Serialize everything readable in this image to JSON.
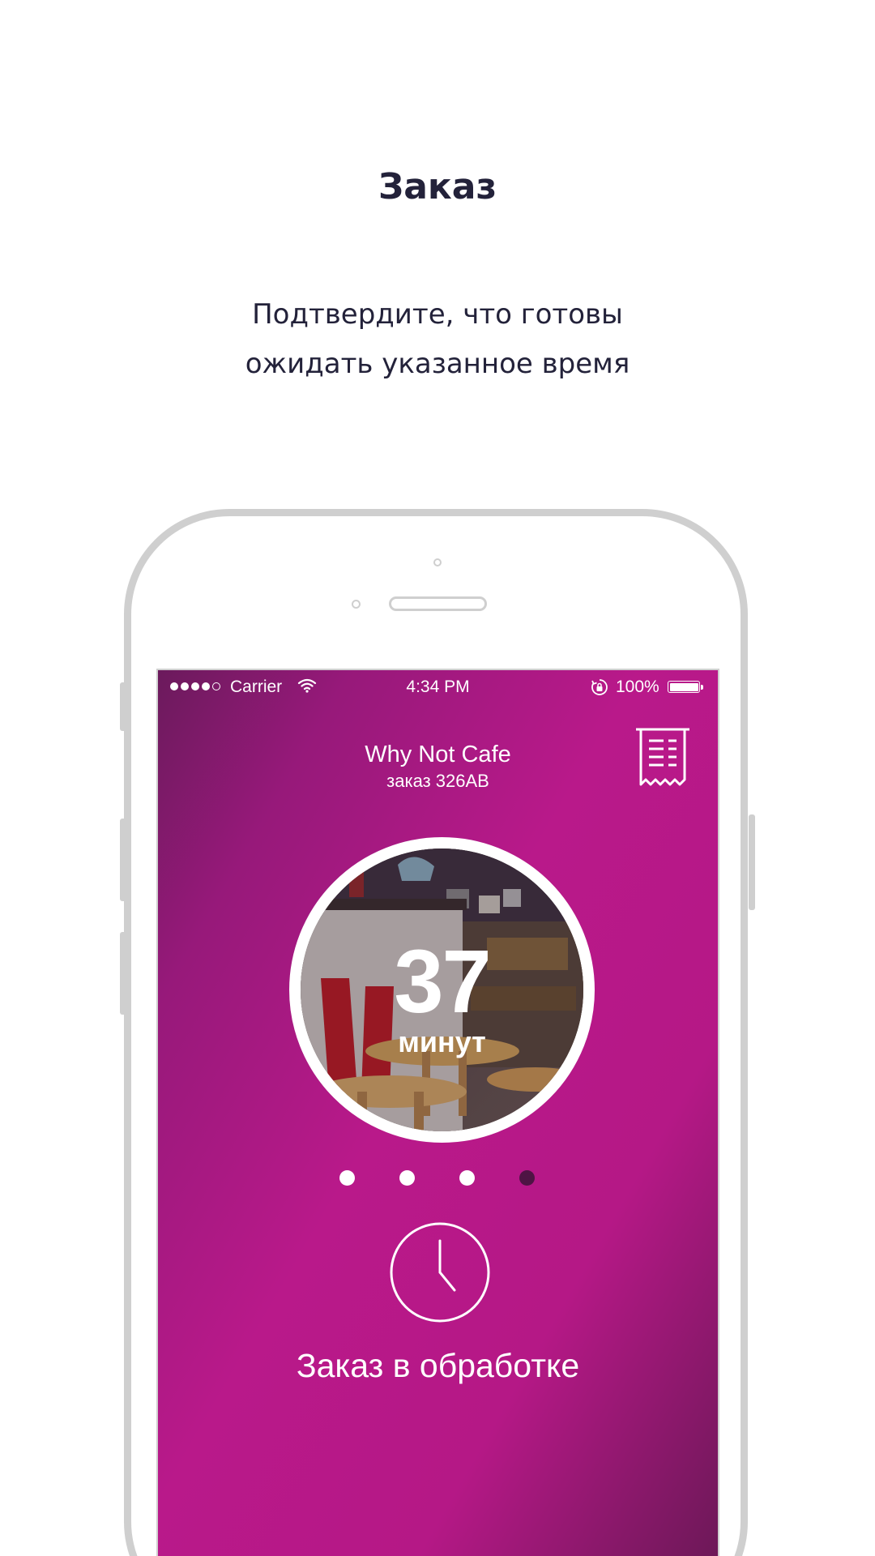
{
  "header": {
    "title": "Заказ",
    "subtitle_lines": [
      "Подтвердите, что готовы",
      "ожидать указанное время"
    ]
  },
  "status_bar": {
    "carrier": "Carrier",
    "time": "4:34 PM",
    "battery": "100%",
    "signal_bars_filled": 4,
    "signal_bars_total": 5
  },
  "app": {
    "cafe_name": "Why Not Cafe",
    "order_number": "заказ 326AB",
    "timer": {
      "value": "37",
      "unit": "минут"
    },
    "pager": {
      "count": 4,
      "active_index": 3
    },
    "status_text": "Заказ в обработке",
    "icons": {
      "receipt": "receipt-icon",
      "clock": "clock-icon"
    },
    "colors": {
      "background_gradient": [
        "#6b1a5c",
        "#b9198a",
        "#6d1858"
      ],
      "accent": "#b9198a",
      "active_dot": "#4e1444"
    }
  }
}
